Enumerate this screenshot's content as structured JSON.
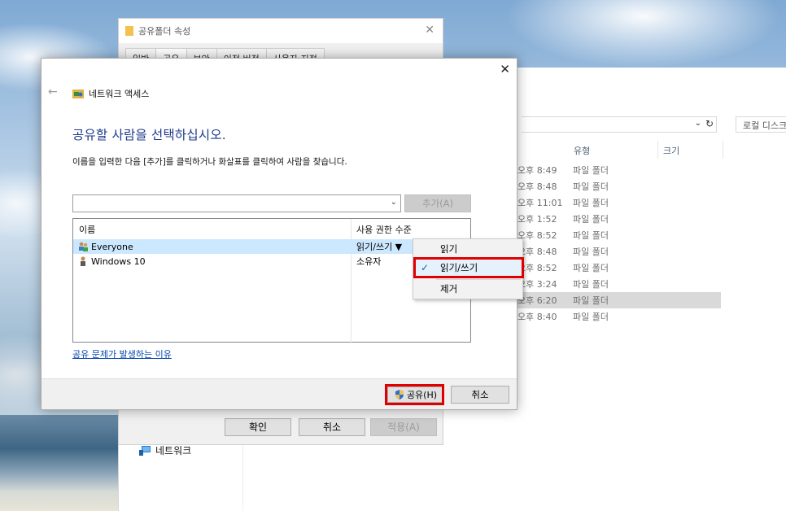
{
  "explorer": {
    "search_placeholder": "로컬 디스크",
    "columns": {
      "type": "유형",
      "size": "크기"
    },
    "rows": [
      {
        "time": "오후 8:49",
        "type": "파일 폴더"
      },
      {
        "time": "오후 8:48",
        "type": "파일 폴더"
      },
      {
        "time": "오후 11:01",
        "type": "파일 폴더"
      },
      {
        "time": "오후 1:52",
        "type": "파일 폴더"
      },
      {
        "time": "오후 8:52",
        "type": "파일 폴더"
      },
      {
        "time": "오후 8:48",
        "type": "파일 폴더"
      },
      {
        "time": "오후 8:52",
        "type": "파일 폴더"
      },
      {
        "time": "오후 3:24",
        "type": "파일 폴더"
      },
      {
        "time": "오후 6:20",
        "type": "파일 폴더"
      },
      {
        "time": "오후 8:40",
        "type": "파일 폴더"
      }
    ],
    "nav_network": "네트워크"
  },
  "properties": {
    "title": "공유폴더 속성",
    "tabs": [
      "일반",
      "공유",
      "보안",
      "이전 버전",
      "사용자 지정"
    ],
    "ok_label": "확인",
    "cancel_label": "취소",
    "apply_label": "적용(A)"
  },
  "network_access": {
    "header_title": "네트워크 액세스",
    "heading": "공유할 사람을 선택하십시오.",
    "instruction": "이름을 입력한 다음 [추가]를 클릭하거나 화살표를 클릭하여 사람을 찾습니다.",
    "add_label": "추가(A)",
    "col_name": "이름",
    "col_permission": "사용 권한 수준",
    "entries": [
      {
        "name": "Everyone",
        "permission": "읽기/쓰기 ▼"
      },
      {
        "name": "Windows 10",
        "permission": "소유자"
      }
    ],
    "link": "공유 문제가 발생하는 이유",
    "share_label": "공유(H)",
    "cancel_label": "취소"
  },
  "context_menu": {
    "items": [
      "읽기",
      "읽기/쓰기",
      "제거"
    ],
    "checked_index": 1
  },
  "colors": {
    "highlight": "#e00000",
    "accent": "#1e3a8a",
    "selection": "#cce8ff"
  }
}
